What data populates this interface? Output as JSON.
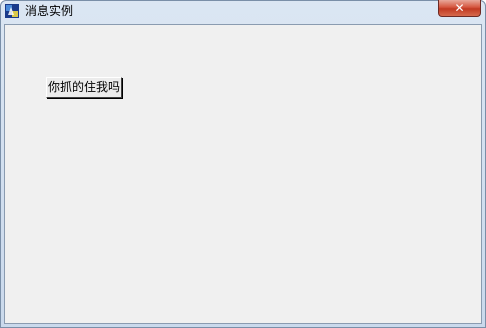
{
  "window": {
    "title": "消息实例"
  },
  "titlebar": {
    "icon": "app-icon",
    "close_icon": "✕"
  },
  "main": {
    "button_label": "你抓的住我吗"
  },
  "colors": {
    "client_background": "#f0f0f0",
    "close_button": "#c13a22"
  }
}
